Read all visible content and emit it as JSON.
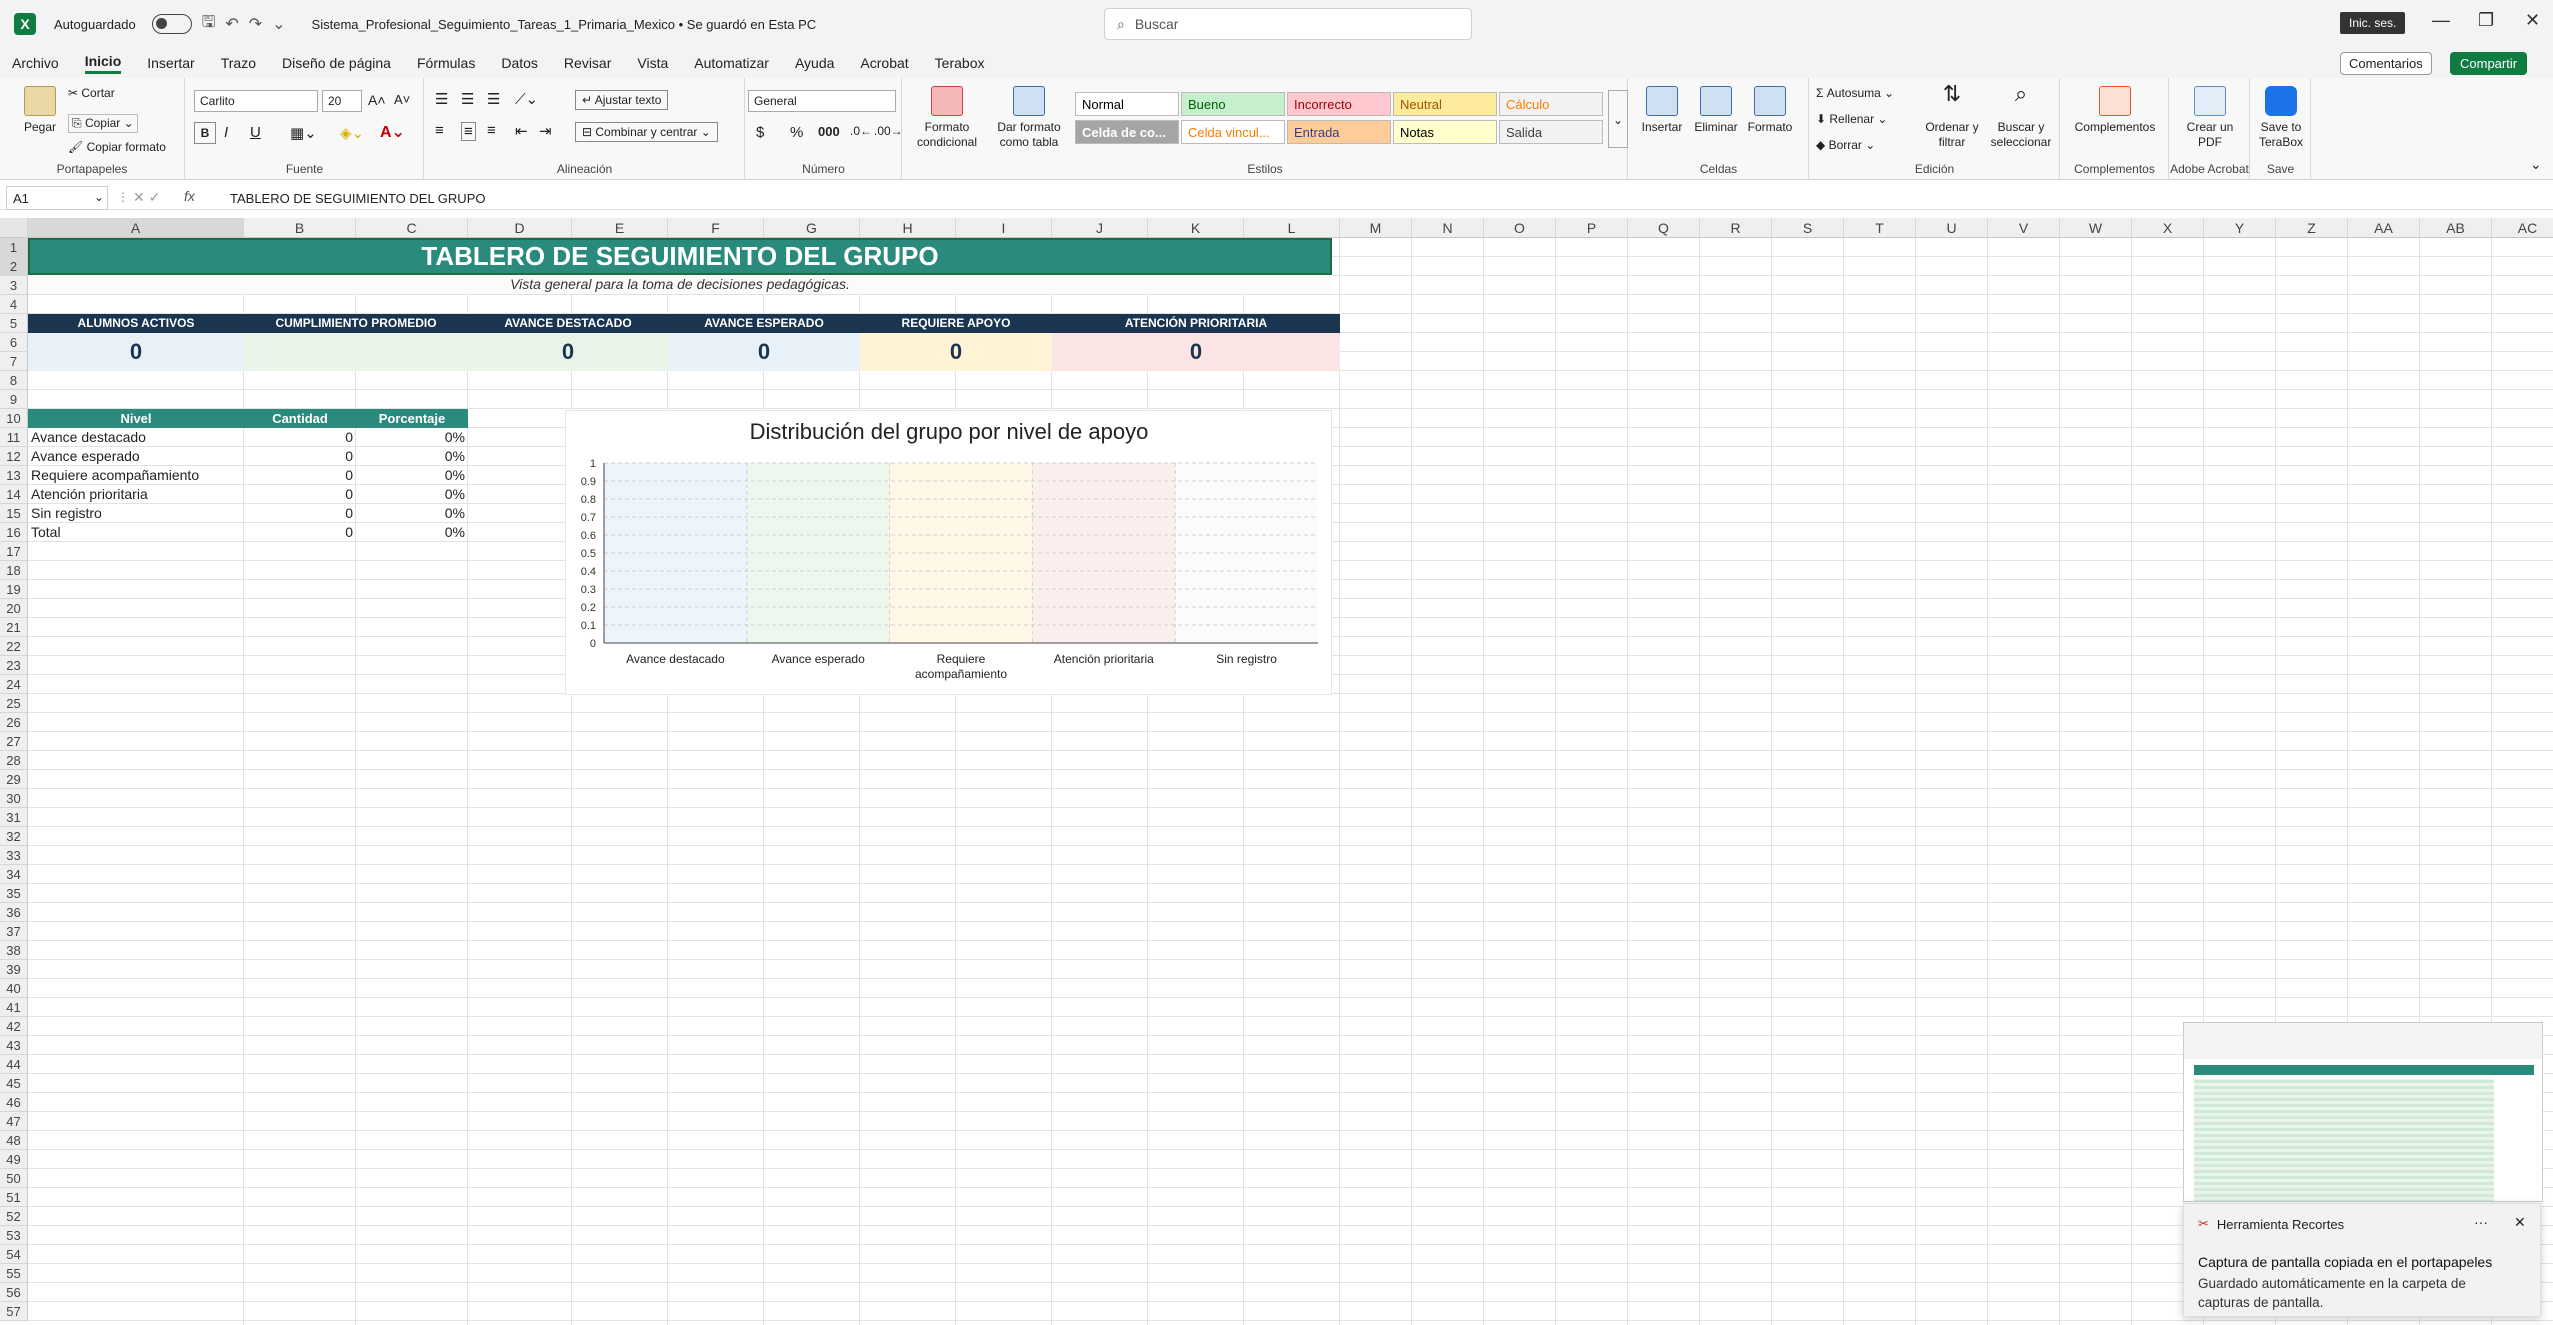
{
  "titlebar": {
    "autosave_label": "Autoguardado",
    "doc_title": "Sistema_Profesional_Seguimiento_Tareas_1_Primaria_Mexico • Se guardó en Esta PC",
    "search_placeholder": "Buscar",
    "signin": "Inic. ses."
  },
  "menu": {
    "tabs": [
      "Archivo",
      "Inicio",
      "Insertar",
      "Trazo",
      "Diseño de página",
      "Fórmulas",
      "Datos",
      "Revisar",
      "Vista",
      "Automatizar",
      "Ayuda",
      "Acrobat",
      "Terabox"
    ],
    "comments": "Comentarios",
    "share": "Compartir"
  },
  "ribbon": {
    "clipboard": {
      "paste": "Pegar",
      "cut": "Cortar",
      "copy": "Copiar",
      "format_painter": "Copiar formato",
      "label": "Portapapeles"
    },
    "font": {
      "name": "Carlito",
      "size": "20",
      "bold": "B",
      "italic": "I",
      "underline": "U",
      "label": "Fuente"
    },
    "alignment": {
      "wrap": "Ajustar texto",
      "merge": "Combinar y centrar",
      "label": "Alineación"
    },
    "number": {
      "format": "General",
      "currency": "$",
      "percent": "%",
      "thousands": "000",
      "label": "Número"
    },
    "styles": {
      "conditional": "Formato condicional",
      "as_table": "Dar formato como tabla",
      "cells": [
        {
          "name": "Normal",
          "bg": "#ffffff",
          "fg": "#000000"
        },
        {
          "name": "Bueno",
          "bg": "#c6efce",
          "fg": "#006100"
        },
        {
          "name": "Incorrecto",
          "bg": "#ffc7ce",
          "fg": "#9c0006"
        },
        {
          "name": "Neutral",
          "bg": "#ffeb9c",
          "fg": "#9c5700"
        },
        {
          "name": "Cálculo",
          "bg": "#f2f2f2",
          "fg": "#fa7d00"
        },
        {
          "name": "Celda de co...",
          "bg": "#a5a5a5",
          "fg": "#ffffff"
        },
        {
          "name": "Celda vincul...",
          "bg": "#ffffff",
          "fg": "#fa7d00"
        },
        {
          "name": "Entrada",
          "bg": "#ffcc99",
          "fg": "#3f3f76"
        },
        {
          "name": "Notas",
          "bg": "#ffffcc",
          "fg": "#000000"
        },
        {
          "name": "Salida",
          "bg": "#f2f2f2",
          "fg": "#3f3f3f"
        }
      ],
      "label": "Estilos"
    },
    "cells": {
      "insert": "Insertar",
      "delete": "Eliminar",
      "format": "Formato",
      "label": "Celdas"
    },
    "editing": {
      "autosum": "Autosuma",
      "fill": "Rellenar",
      "clear": "Borrar",
      "sort": "Ordenar y filtrar",
      "find": "Buscar y seleccionar",
      "label": "Edición"
    },
    "addins": {
      "name": "Complementos",
      "label": "Complementos"
    },
    "acrobat": {
      "name": "Crear un PDF",
      "label": "Adobe Acrobat"
    },
    "save": {
      "name": "Save to TeraBox",
      "label": "Save"
    }
  },
  "formula_bar": {
    "name_box": "A1",
    "fx": "fx",
    "content": "TABLERO DE SEGUIMIENTO DEL GRUPO"
  },
  "columns": [
    "A",
    "B",
    "C",
    "D",
    "E",
    "F",
    "G",
    "H",
    "I",
    "J",
    "K",
    "L",
    "M",
    "N",
    "O",
    "P",
    "Q",
    "R",
    "S",
    "T",
    "U",
    "V",
    "W",
    "X",
    "Y",
    "Z",
    "AA",
    "AB",
    "AC"
  ],
  "rows": [
    "1",
    "2",
    "3",
    "4",
    "5",
    "6",
    "7",
    "8",
    "9",
    "10",
    "11",
    "12",
    "13",
    "14",
    "15",
    "16",
    "17",
    "18",
    "19",
    "20",
    "21",
    "22",
    "23",
    "24",
    "25",
    "26",
    "27",
    "28",
    "29",
    "30",
    "31",
    "32",
    "33",
    "34",
    "35",
    "36",
    "37",
    "38",
    "39",
    "40",
    "41",
    "42",
    "43",
    "44",
    "45",
    "46",
    "47",
    "48",
    "49",
    "50",
    "51",
    "52",
    "53",
    "54",
    "55",
    "56",
    "57"
  ],
  "sheet": {
    "title": "TABLERO DE SEGUIMIENTO DEL GRUPO",
    "subtitle": "Vista general para la toma de decisiones pedagógicas.",
    "kpis": [
      {
        "label": "ALUMNOS ACTIVOS",
        "value": "0",
        "bg": "#e8f0f8"
      },
      {
        "label": "CUMPLIMIENTO PROMEDIO",
        "value": "",
        "bg": "#e8f4e8"
      },
      {
        "label": "AVANCE DESTACADO",
        "value": "0",
        "bg": "#e8f4e8"
      },
      {
        "label": "AVANCE ESPERADO",
        "value": "0",
        "bg": "#e8f0f8"
      },
      {
        "label": "REQUIERE APOYO",
        "value": "0",
        "bg": "#fff3d6"
      },
      {
        "label": "ATENCIÓN PRIORITARIA",
        "value": "0",
        "bg": "#fbe4e4"
      }
    ],
    "table": {
      "headers": [
        "Nivel",
        "Cantidad",
        "Porcentaje"
      ],
      "rows": [
        [
          "Avance destacado",
          "0",
          "0%"
        ],
        [
          "Avance esperado",
          "0",
          "0%"
        ],
        [
          "Requiere acompañamiento",
          "0",
          "0%"
        ],
        [
          "Atención prioritaria",
          "0",
          "0%"
        ],
        [
          "Sin registro",
          "0",
          "0%"
        ],
        [
          "Total",
          "0",
          "0%"
        ]
      ]
    }
  },
  "chart_data": {
    "type": "bar",
    "title": "Distribución del grupo por nivel de apoyo",
    "categories": [
      "Avance destacado",
      "Avance esperado",
      "Requiere acompañamiento",
      "Atención prioritaria",
      "Sin registro"
    ],
    "values": [
      0,
      0,
      0,
      0,
      0
    ],
    "yticks": [
      "0",
      "0.1",
      "0.2",
      "0.3",
      "0.4",
      "0.5",
      "0.6",
      "0.7",
      "0.8",
      "0.9",
      "1"
    ],
    "ylim": [
      0,
      1
    ],
    "band_colors": [
      "#eef4fb",
      "#eef7ee",
      "#fff8e6",
      "#fdeeee",
      "#fbfbfb"
    ],
    "grid": true
  },
  "toast": {
    "app": "Herramienta Recortes",
    "title": "Captura de pantalla copiada en el portapapeles",
    "body": "Guardado automáticamente en la carpeta de capturas de pantalla."
  }
}
